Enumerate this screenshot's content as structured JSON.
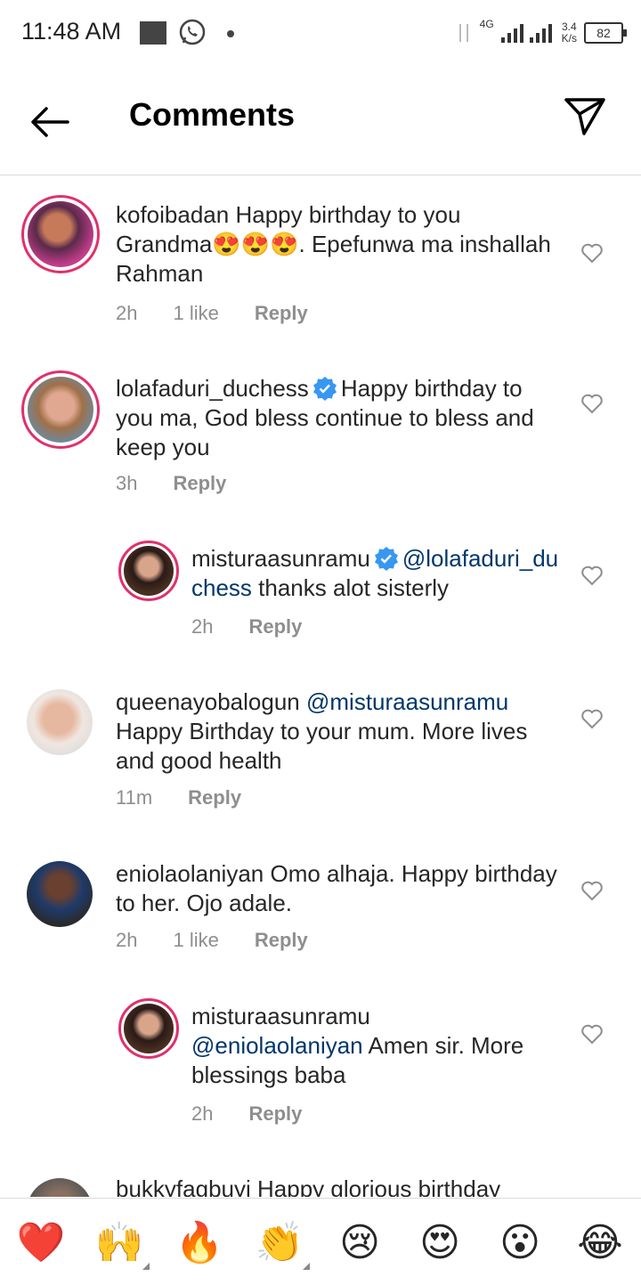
{
  "status_bar": {
    "time": "11:48 AM",
    "network": "4G",
    "speed_value": "3.4",
    "speed_unit": "K/s",
    "battery": "82"
  },
  "header": {
    "title": "Comments",
    "back_icon": "arrow-left-icon",
    "send_icon": "paper-plane-icon"
  },
  "comments": [
    {
      "username": "kofoibadan",
      "verified": false,
      "text": "Happy birthday to you Grandma😍😍😍. Epefunwa ma inshallah Rahman",
      "time": "2h",
      "likes": "1 like",
      "reply": "Reply"
    },
    {
      "username": "lolafaduri_duchess",
      "verified": true,
      "text": "Happy birthday to you ma, God bless continue to bless and keep you",
      "time": "3h",
      "reply": "Reply"
    },
    {
      "username": "misturaasunramu",
      "verified": true,
      "mention": "@lolafaduri_duchess",
      "text": "thanks alot sisterly",
      "time": "2h",
      "reply": "Reply"
    },
    {
      "username": "queenayobalogun",
      "verified": false,
      "mention": "@misturaasunramu",
      "text": "Happy Birthday to your mum. More lives and good health",
      "time": "11m",
      "reply": "Reply"
    },
    {
      "username": "eniolaolaniyan",
      "verified": false,
      "text": "Omo alhaja.  Happy birthday to her. Ojo adale.",
      "time": "2h",
      "likes": "1 like",
      "reply": "Reply"
    },
    {
      "username": "misturaasunramu",
      "verified": false,
      "mention": "@eniolaolaniyan",
      "text": "Amen sir. More blessings baba",
      "time": "2h",
      "reply": "Reply"
    },
    {
      "username": "bukkyfagbuyi",
      "verified": false,
      "text": "Happy glorious birthday"
    }
  ],
  "emoji_bar": [
    "❤️",
    "🙌",
    "🔥",
    "👏",
    "😢",
    "😍",
    "😮",
    "😂"
  ],
  "colors": {
    "mention": "#00376b",
    "meta": "#8e8e8e",
    "story_ring": "#e1306c",
    "verified": "#3897f0"
  }
}
